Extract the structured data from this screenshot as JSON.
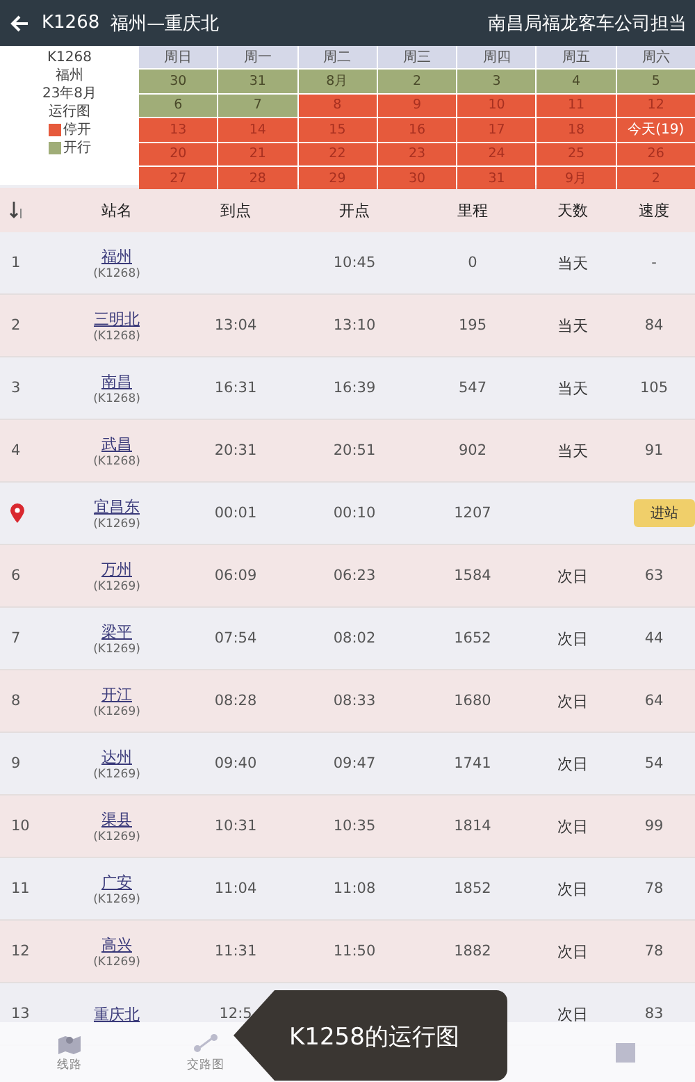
{
  "header": {
    "train": "K1268",
    "route": "福州—重庆北",
    "operator": "南昌局福龙客车公司担当"
  },
  "calendar": {
    "info": [
      "K1268",
      "福州",
      "23年8月",
      "运行图"
    ],
    "legend": [
      {
        "running": false,
        "label": "停开"
      },
      {
        "running": true,
        "label": "开行"
      }
    ],
    "weekdays": [
      "周日",
      "周一",
      "周二",
      "周三",
      "周四",
      "周五",
      "周六"
    ],
    "weeks": [
      [
        {
          "day": "30",
          "running": true,
          "today": false
        },
        {
          "day": "31",
          "running": true,
          "today": false
        },
        {
          "day": "8月",
          "running": true,
          "today": false
        },
        {
          "day": "2",
          "running": true,
          "today": false
        },
        {
          "day": "3",
          "running": true,
          "today": false
        },
        {
          "day": "4",
          "running": true,
          "today": false
        },
        {
          "day": "5",
          "running": true,
          "today": false
        }
      ],
      [
        {
          "day": "6",
          "running": true,
          "today": false
        },
        {
          "day": "7",
          "running": true,
          "today": false
        },
        {
          "day": "8",
          "running": false,
          "today": false
        },
        {
          "day": "9",
          "running": false,
          "today": false
        },
        {
          "day": "10",
          "running": false,
          "today": false
        },
        {
          "day": "11",
          "running": false,
          "today": false
        },
        {
          "day": "12",
          "running": false,
          "today": false
        }
      ],
      [
        {
          "day": "13",
          "running": false,
          "today": false
        },
        {
          "day": "14",
          "running": false,
          "today": false
        },
        {
          "day": "15",
          "running": false,
          "today": false
        },
        {
          "day": "16",
          "running": false,
          "today": false
        },
        {
          "day": "17",
          "running": false,
          "today": false
        },
        {
          "day": "18",
          "running": false,
          "today": false
        },
        {
          "day": "今天(19)",
          "running": false,
          "today": true
        }
      ],
      [
        {
          "day": "20",
          "running": false,
          "today": false
        },
        {
          "day": "21",
          "running": false,
          "today": false
        },
        {
          "day": "22",
          "running": false,
          "today": false
        },
        {
          "day": "23",
          "running": false,
          "today": false
        },
        {
          "day": "24",
          "running": false,
          "today": false
        },
        {
          "day": "25",
          "running": false,
          "today": false
        },
        {
          "day": "26",
          "running": false,
          "today": false
        }
      ],
      [
        {
          "day": "27",
          "running": false,
          "today": false
        },
        {
          "day": "28",
          "running": false,
          "today": false
        },
        {
          "day": "29",
          "running": false,
          "today": false
        },
        {
          "day": "30",
          "running": false,
          "today": false
        },
        {
          "day": "31",
          "running": false,
          "today": false
        },
        {
          "day": "9月",
          "running": false,
          "today": false
        },
        {
          "day": "2",
          "running": false,
          "today": false
        }
      ]
    ]
  },
  "table": {
    "columns": [
      "站名",
      "到点",
      "开点",
      "里程",
      "天数",
      "速度"
    ],
    "rows": [
      {
        "kind": "stop",
        "no": "1",
        "station": "福州",
        "code": "(K1268)",
        "depart": "10:45",
        "km": "0",
        "day": "当天",
        "speed": "-"
      },
      {
        "kind": "stop",
        "no": "2",
        "station": "三明北",
        "code": "(K1268)",
        "arrive": "13:04",
        "depart": "13:10",
        "km": "195",
        "day": "当天",
        "speed": "84"
      },
      {
        "kind": "stop",
        "no": "3",
        "station": "南昌",
        "code": "(K1268)",
        "arrive": "16:31",
        "depart": "16:39",
        "km": "547",
        "day": "当天",
        "speed": "105"
      },
      {
        "kind": "stop",
        "no": "4",
        "station": "武昌",
        "code": "(K1268)",
        "arrive": "20:31",
        "depart": "20:51",
        "km": "902",
        "day": "当天",
        "speed": "91"
      },
      {
        "kind": "current",
        "station": "宜昌东",
        "code": "(K1269)",
        "arrive": "00:01",
        "depart": "00:10",
        "km": "1207",
        "badge": "进站"
      },
      {
        "kind": "stop",
        "no": "6",
        "station": "万州",
        "code": "(K1269)",
        "arrive": "06:09",
        "depart": "06:23",
        "km": "1584",
        "day": "次日",
        "speed": "63"
      },
      {
        "kind": "stop",
        "no": "7",
        "station": "梁平",
        "code": "(K1269)",
        "arrive": "07:54",
        "depart": "08:02",
        "km": "1652",
        "day": "次日",
        "speed": "44"
      },
      {
        "kind": "stop",
        "no": "8",
        "station": "开江",
        "code": "(K1269)",
        "arrive": "08:28",
        "depart": "08:33",
        "km": "1680",
        "day": "次日",
        "speed": "64"
      },
      {
        "kind": "stop",
        "no": "9",
        "station": "达州",
        "code": "(K1269)",
        "arrive": "09:40",
        "depart": "09:47",
        "km": "1741",
        "day": "次日",
        "speed": "54"
      },
      {
        "kind": "stop",
        "no": "10",
        "station": "渠县",
        "code": "(K1269)",
        "arrive": "10:31",
        "depart": "10:35",
        "km": "1814",
        "day": "次日",
        "speed": "99"
      },
      {
        "kind": "stop",
        "no": "11",
        "station": "广安",
        "code": "(K1269)",
        "arrive": "11:04",
        "depart": "11:08",
        "km": "1852",
        "day": "次日",
        "speed": "78"
      },
      {
        "kind": "stop",
        "no": "12",
        "station": "高兴",
        "code": "(K1269)",
        "arrive": "11:31",
        "depart": "11:50",
        "km": "1882",
        "day": "次日",
        "speed": "78"
      },
      {
        "kind": "stop",
        "no": "13",
        "station": "重庆北",
        "arrive": "12:5",
        "day": "次日",
        "speed": "83"
      }
    ]
  },
  "nav": [
    {
      "kind": "map",
      "label": "线路"
    },
    {
      "kind": "route",
      "label": "交路图"
    },
    {
      "kind": "board"
    }
  ],
  "tooltip": "K1258的运行图"
}
